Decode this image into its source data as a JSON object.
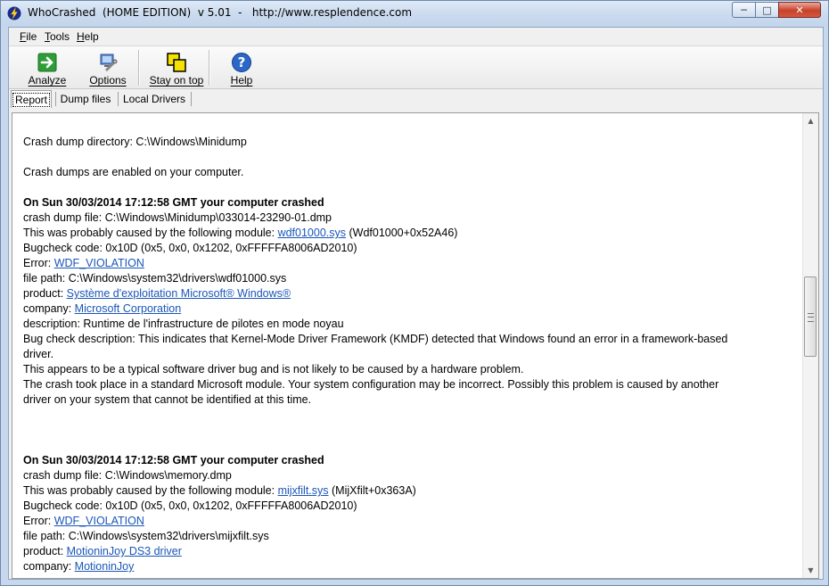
{
  "window": {
    "title": "WhoCrashed  (HOME EDITION)  v 5.01  -   http://www.resplendence.com"
  },
  "menu": [
    {
      "key": "F",
      "rest": "ile"
    },
    {
      "key": "T",
      "rest": "ools"
    },
    {
      "key": "H",
      "rest": "elp"
    }
  ],
  "toolbar": {
    "analyze": "Analyze",
    "options": "Options",
    "stay_on_top": "Stay on top",
    "help": "Help"
  },
  "tabs": [
    "Report",
    "Dump files",
    "Local Drivers"
  ],
  "report": {
    "dir_label": "Crash dump directory: C:\\Windows\\Minidump",
    "enabled": "Crash dumps are enabled on your computer.",
    "crash1": {
      "heading": "On Sun 30/03/2014 17:12:58 GMT your computer crashed",
      "dump_file": "crash dump file: C:\\Windows\\Minidump\\033014-23290-01.dmp",
      "caused_prefix": "This was probably caused by the following module: ",
      "module": "wdf01000.sys",
      "module_suffix": " (Wdf01000+0x52A46)",
      "bugcheck": "Bugcheck code: 0x10D (0x5, 0x0, 0x1202, 0xFFFFFA8006AD2010)",
      "error_prefix": "Error: ",
      "error": "WDF_VIOLATION",
      "file_path": "file path: C:\\Windows\\system32\\drivers\\wdf01000.sys",
      "product_prefix": "product: ",
      "product": "Système d'exploitation Microsoft® Windows®",
      "company_prefix": "company: ",
      "company": "Microsoft Corporation",
      "description": "description: Runtime de l'infrastructure de pilotes en mode noyau",
      "bugcheck_desc_1": "Bug check description: This indicates that Kernel-Mode Driver Framework (KMDF) detected that Windows found an error in a framework-based",
      "bugcheck_desc_2": "driver.",
      "note": "This appears to be a typical software driver bug and is not likely to be caused by a hardware problem.",
      "place_1": "The crash took place in a standard Microsoft module. Your system configuration may be incorrect. Possibly this problem is caused by another",
      "place_2": "driver on your system that cannot be identified at this time."
    },
    "crash2": {
      "heading": "On Sun 30/03/2014 17:12:58 GMT your computer crashed",
      "dump_file": "crash dump file: C:\\Windows\\memory.dmp",
      "caused_prefix": "This was probably caused by the following module: ",
      "module": "mijxfilt.sys",
      "module_suffix": " (MijXfilt+0x363A)",
      "bugcheck": "Bugcheck code: 0x10D (0x5, 0x0, 0x1202, 0xFFFFFA8006AD2010)",
      "error_prefix": "Error: ",
      "error": "WDF_VIOLATION",
      "file_path": "file path: C:\\Windows\\system32\\drivers\\mijxfilt.sys",
      "product_prefix": "product: ",
      "product": "MotioninJoy DS3 driver",
      "company_prefix": "company: ",
      "company": "MotioninJoy"
    }
  }
}
